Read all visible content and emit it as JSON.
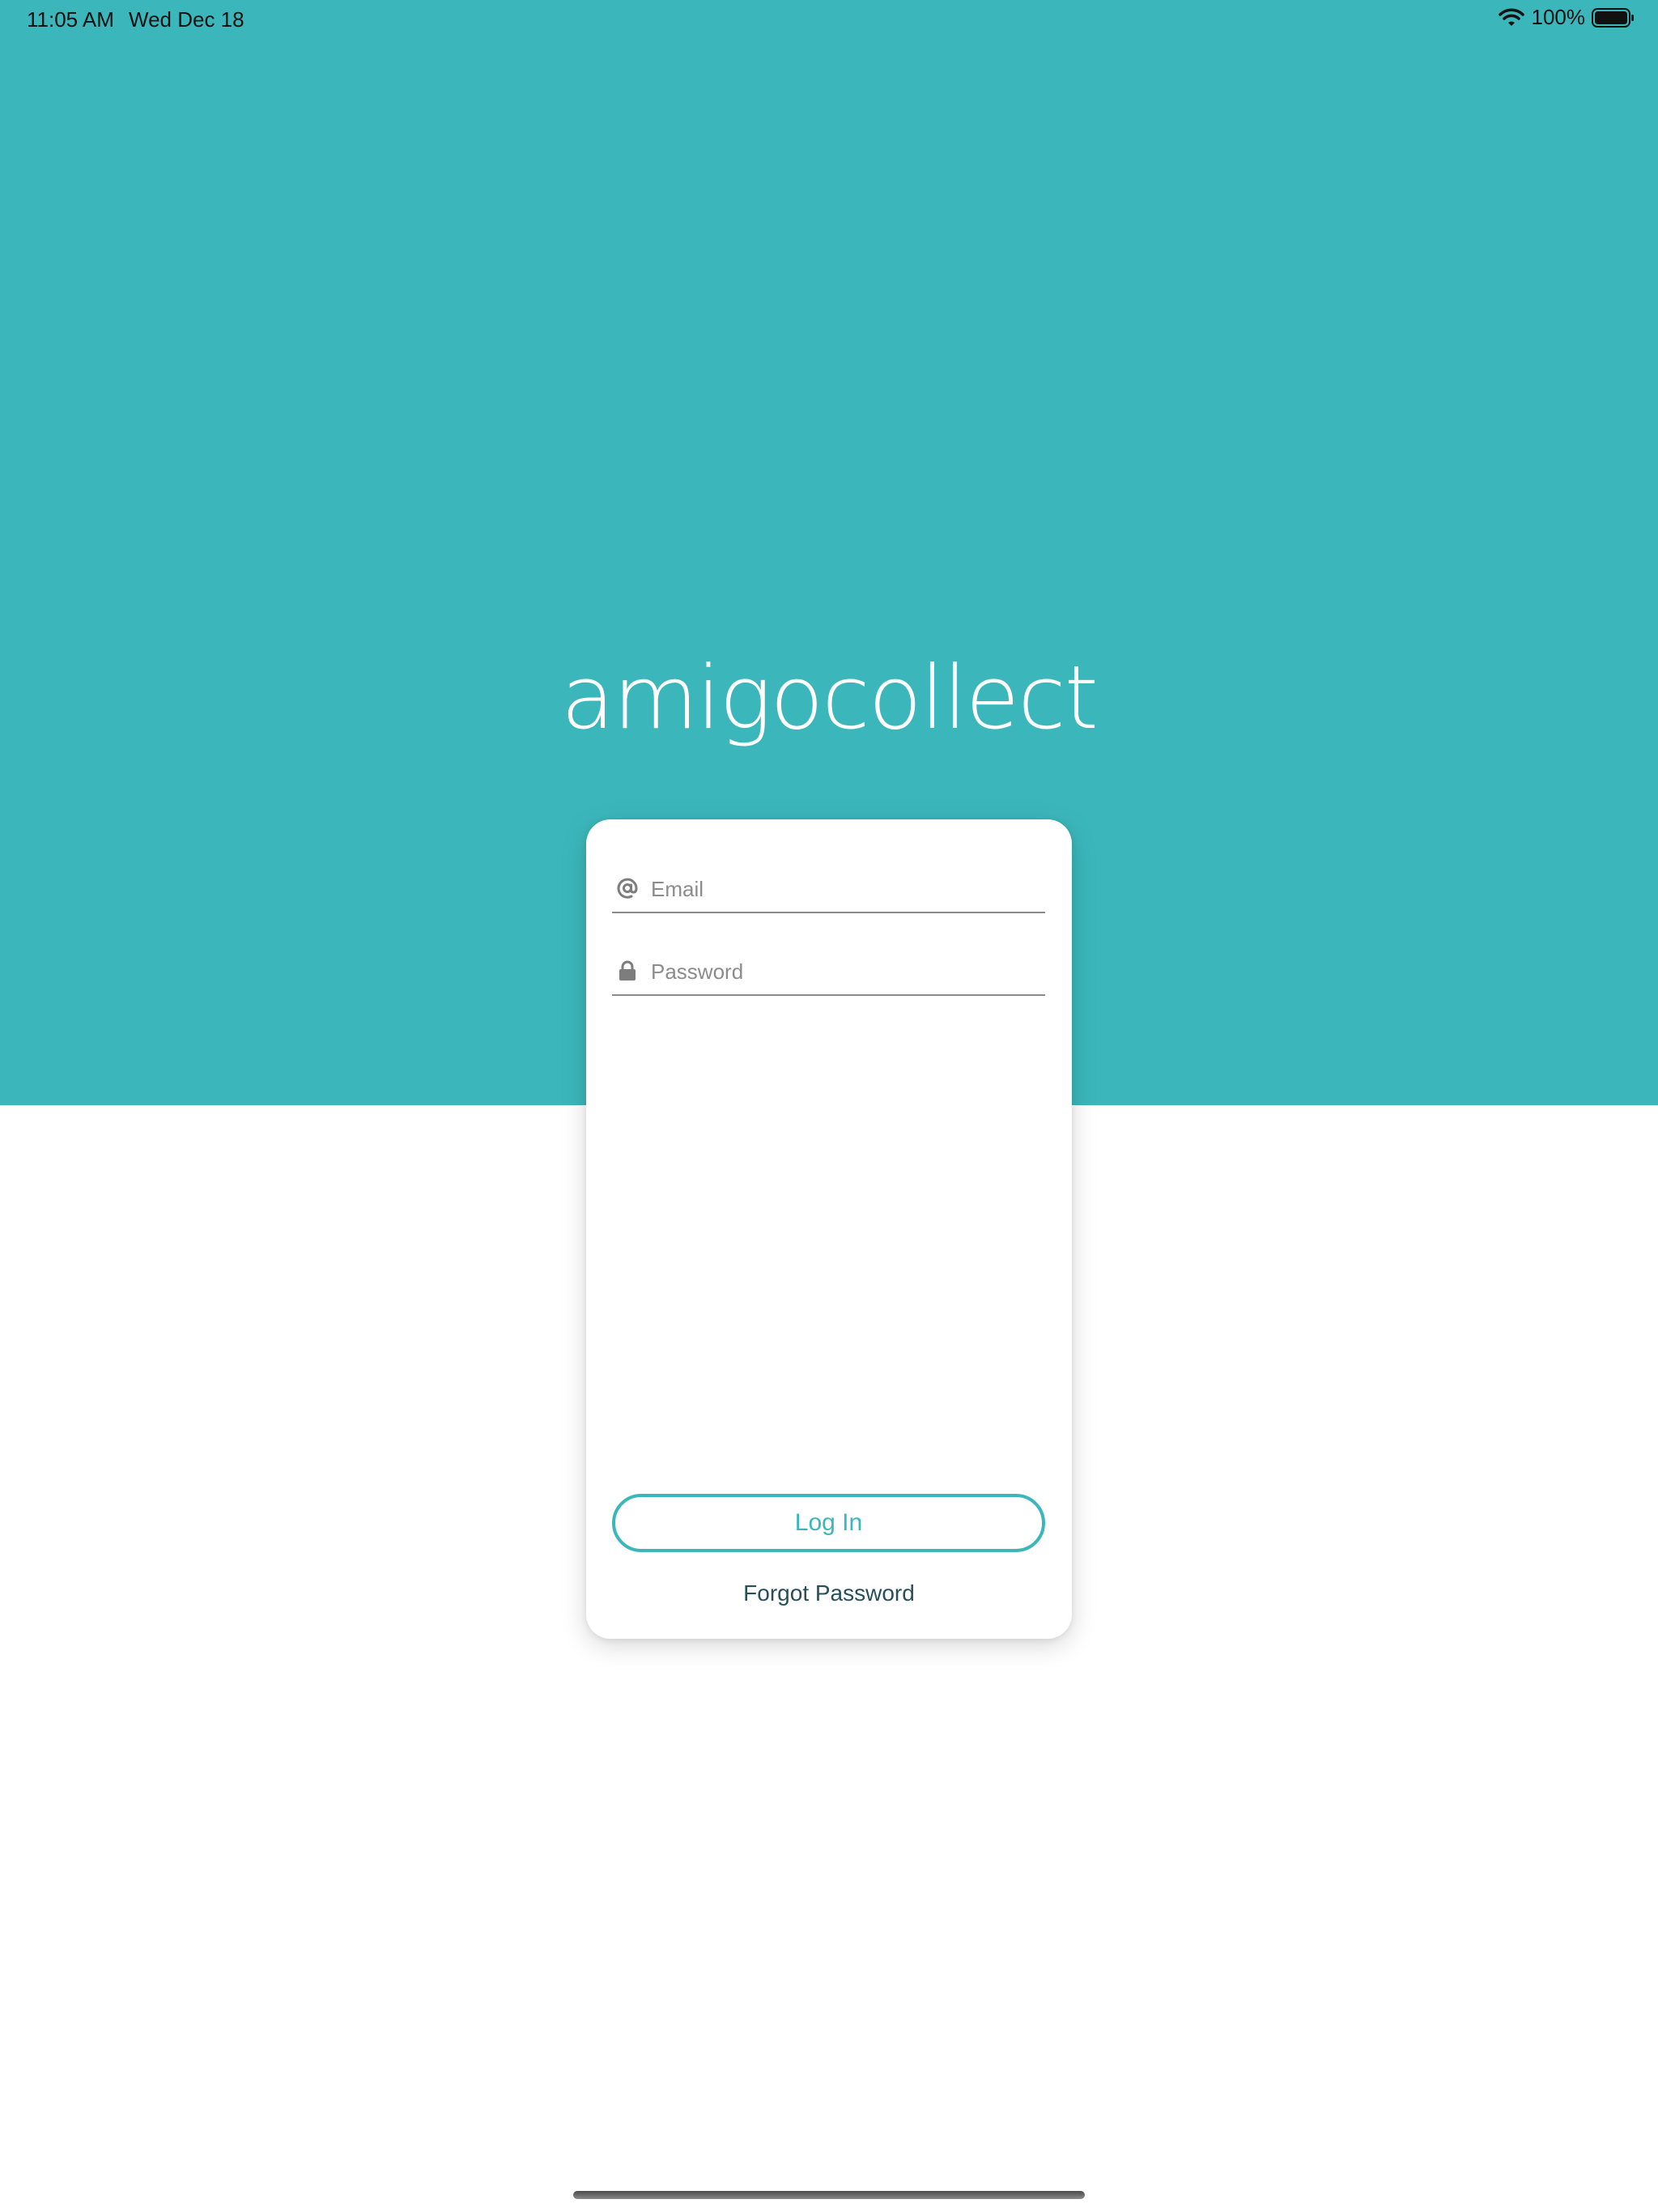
{
  "status_bar": {
    "time": "11:05 AM",
    "date": "Wed Dec 18",
    "battery": "100%",
    "wifi_icon": "wifi-icon",
    "battery_icon": "battery-full-icon"
  },
  "brand": {
    "logo_text": "amigocollect",
    "primary_color": "#3bb7bb"
  },
  "login_form": {
    "email": {
      "icon": "at-sign-icon",
      "placeholder": "Email",
      "value": ""
    },
    "password": {
      "icon": "lock-icon",
      "placeholder": "Password",
      "value": ""
    },
    "login_label": "Log In",
    "forgot_label": "Forgot Password"
  }
}
